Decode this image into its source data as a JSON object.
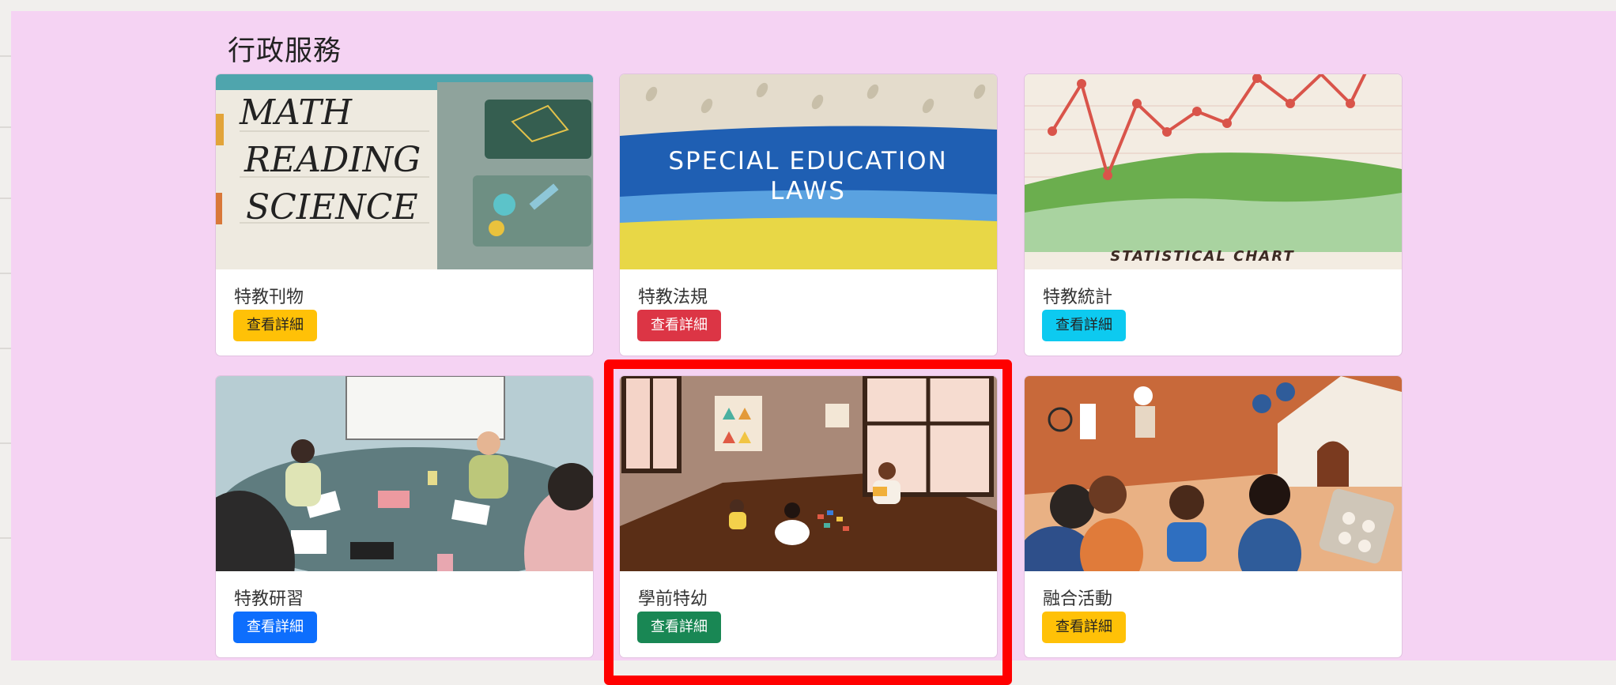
{
  "section": {
    "title": "行政服務"
  },
  "cards": [
    {
      "title": "特教刊物",
      "button": "查看詳細",
      "image_text": [
        "MATH",
        "READING",
        "SCIENCE"
      ]
    },
    {
      "title": "特教法規",
      "button": "查看詳細",
      "image_text": [
        "SPECIAL EDUCATION",
        "LAWS"
      ]
    },
    {
      "title": "特教統計",
      "button": "查看詳細",
      "image_text": [
        "STATISTICAL CHART"
      ]
    },
    {
      "title": "特教研習",
      "button": "查看詳細"
    },
    {
      "title": "學前特幼",
      "button": "查看詳細"
    },
    {
      "title": "融合活動",
      "button": "查看詳細"
    }
  ],
  "button_colors": {
    "yellow": "#ffc107",
    "red": "#dc3545",
    "cyan": "#0dcaf0",
    "blue": "#0d6efd",
    "green": "#198754"
  },
  "highlight": {
    "color": "#ff0000"
  }
}
